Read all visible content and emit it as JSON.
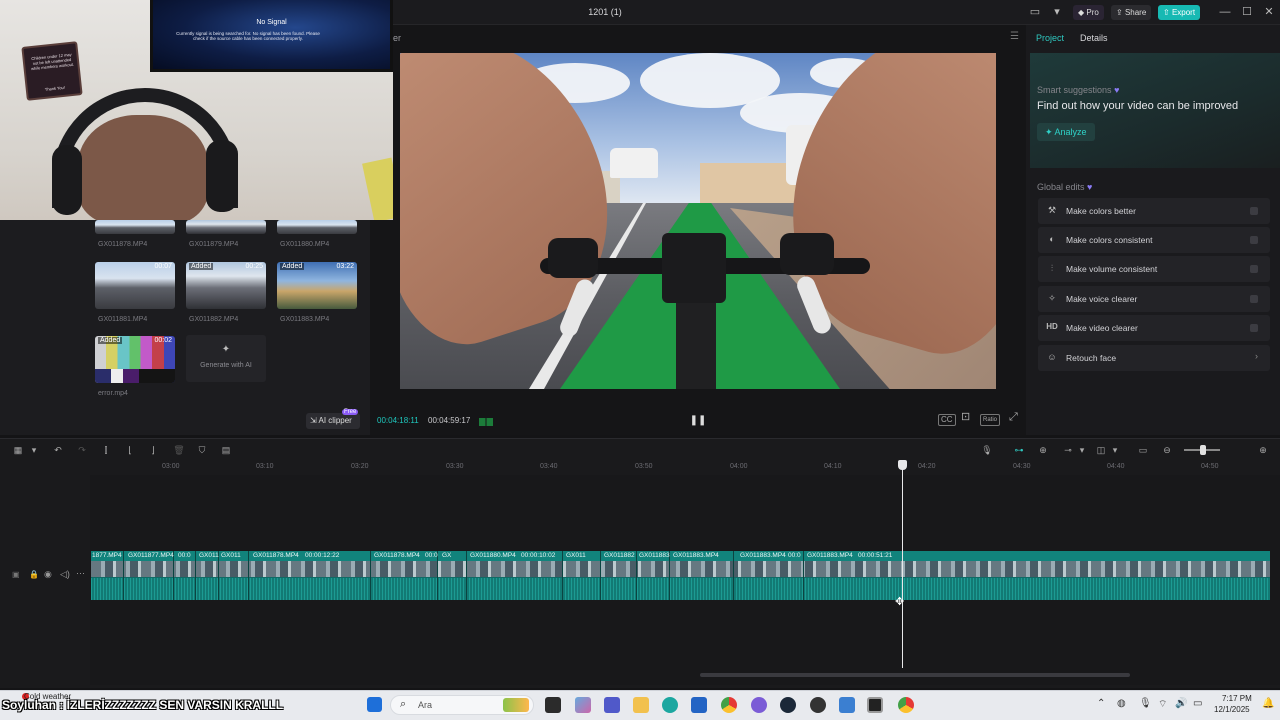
{
  "window": {
    "title": "1201 (1)",
    "pro_label": "Pro",
    "share_label": "Share",
    "export_label": "Export",
    "minimize": "—",
    "maximize": "☐",
    "close": "✕"
  },
  "webcam": {
    "tv_title": "No Signal",
    "tv_message": "Currently signal is being searched for. No signal has been found. Please check if the source cable has been connected properly.",
    "sign_text": "Children under 12 may not be left unattended while members workout.",
    "sign_thanks": "Thank You!"
  },
  "media": {
    "items": [
      {
        "name": "GX011878.MP4",
        "badge": "",
        "duration": ""
      },
      {
        "name": "GX011879.MP4",
        "badge": "",
        "duration": ""
      },
      {
        "name": "GX011880.MP4",
        "badge": "",
        "duration": ""
      },
      {
        "name": "GX011881.MP4",
        "badge": "",
        "duration": "00:07"
      },
      {
        "name": "GX011882.MP4",
        "badge": "Added",
        "duration": "00:25"
      },
      {
        "name": "GX011883.MP4",
        "badge": "Added",
        "duration": "03:22"
      },
      {
        "name": "error.mp4",
        "badge": "Added",
        "duration": "00:02"
      }
    ],
    "generate_label": "Generate with AI",
    "ai_clipper_label": "AI clipper",
    "ai_clipper_badge": "Free"
  },
  "player": {
    "header_label": "er",
    "current_time": "00:04:18:11",
    "total_time": "00:04:59:17",
    "ratio_label": "Ratio"
  },
  "right_panel": {
    "tabs": [
      "Project",
      "Details"
    ],
    "smart_label": "Smart suggestions",
    "smart_title": "Find out how your video can be improved",
    "analyze_label": "Analyze",
    "global_label": "Global edits",
    "global_items": [
      {
        "label": "Make colors better",
        "icon": "wand-icon"
      },
      {
        "label": "Make colors consistent",
        "icon": "palette-icon"
      },
      {
        "label": "Make volume consistent",
        "icon": "sliders-icon"
      },
      {
        "label": "Make voice clearer",
        "icon": "voice-icon"
      },
      {
        "label": "Make video clearer",
        "icon": "hd-icon"
      },
      {
        "label": "Retouch face",
        "icon": "face-icon"
      }
    ]
  },
  "timeline": {
    "ruler": [
      "03:00",
      "03:10",
      "03:20",
      "03:30",
      "03:40",
      "03:50",
      "04:00",
      "04:10",
      "04:20",
      "04:30",
      "04:40",
      "04:50"
    ],
    "clip_labels": [
      "1877.MP4",
      "GX011877.MP4",
      "00:0",
      "GX011",
      "GX011",
      "GX011878.MP4",
      "00:00:12:22",
      "GX011878.MP4",
      "00:0",
      "GX",
      "GX011880.MP4",
      "00:00:10:02",
      "GX011",
      "GX011882",
      "GX011883",
      "GX011883.MP4",
      "GX011883.MP4",
      "00:0",
      "GX011883.MP4",
      "00:00:51:21"
    ]
  },
  "taskbar": {
    "ticker": "Soyluhan : İZLERİZZZZZZZ SEN VARSIN KRALLL",
    "weather": "Cold weather",
    "search_placeholder": "Ara",
    "time": "7:17 PM",
    "date": "12/1/2025"
  },
  "colors": {
    "accent": "#17b9b3",
    "timeline_clip": "#0f6b66",
    "background": "#141416"
  }
}
